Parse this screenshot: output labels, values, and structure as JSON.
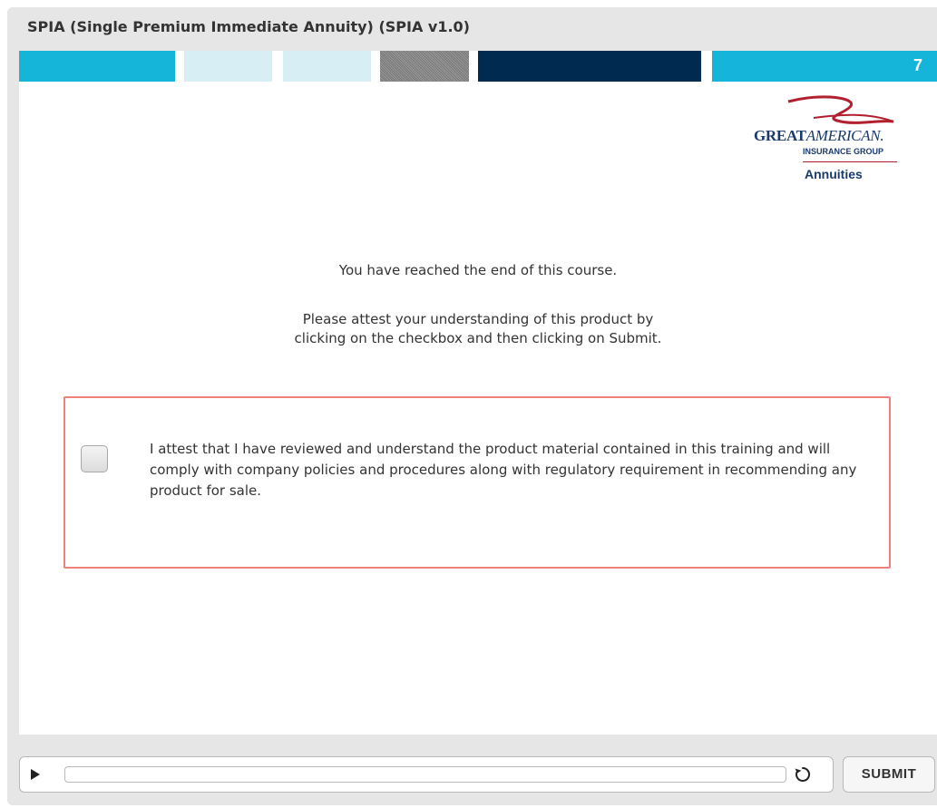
{
  "window": {
    "title": "SPIA (Single Premium Immediate Annuity) (SPIA v1.0)"
  },
  "header": {
    "slide_number": "7",
    "colors": {
      "cyan": "#14b5d9",
      "light_blue": "#d7eef5",
      "gray": "#888888",
      "navy": "#002a50"
    }
  },
  "logo": {
    "great": "GREAT",
    "american": "AMERICAN.",
    "subtitle": "INSURANCE GROUP",
    "product": "Annuities"
  },
  "content": {
    "end_message": "You have reached the end of this course.",
    "instruction_line1": "Please attest your understanding of this product by",
    "instruction_line2": "clicking on the checkbox and then clicking on Submit.",
    "attestation_text": "I attest that I have reviewed and understand the product material contained in this training and will comply with company policies and procedures along with regulatory requirement in recommending any product for sale.",
    "attestation_checked": false,
    "box_border_color": "#f0807b"
  },
  "controls": {
    "play_icon": "play-icon",
    "replay_icon": "replay-icon",
    "progress": 0,
    "submit_label": "SUBMIT"
  }
}
